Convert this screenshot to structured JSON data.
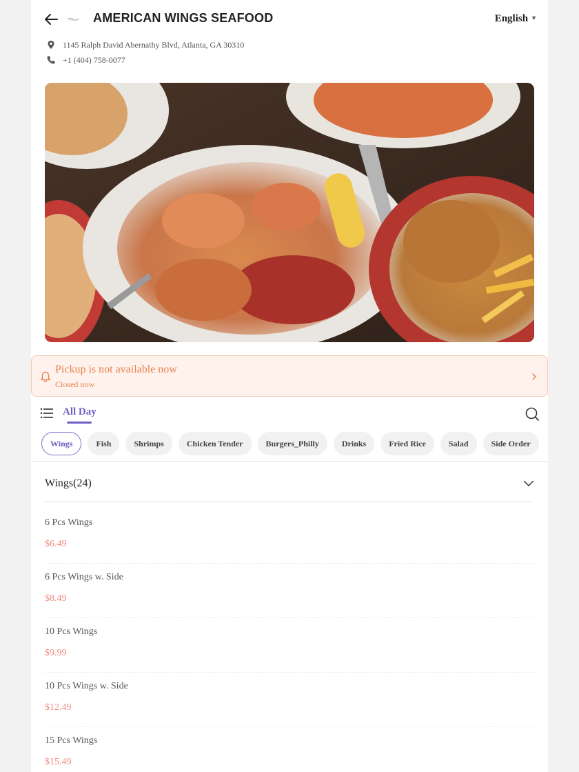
{
  "header": {
    "title": "AMERICAN WINGS SEAFOOD",
    "language": "English",
    "back_icon": "arrow-left-icon",
    "logo": "restaurant-logo"
  },
  "info": {
    "address": "1145 Ralph David Abernathy Blvd, Atlanta, GA 30310",
    "phone": "+1 (404) 758-0077"
  },
  "pickup": {
    "title": "Pickup is not available now",
    "subtitle": "Closed now"
  },
  "menu": {
    "active_menu": "All Day"
  },
  "categories": [
    "Wings",
    "Fish",
    "Shrimps",
    "Chicken Tender",
    "Burgers_Philly",
    "Drinks",
    "Fried Rice",
    "Salad",
    "Side Order"
  ],
  "section": {
    "title": "Wings(24)",
    "items": [
      {
        "name": "6 Pcs Wings",
        "price": "$6.49"
      },
      {
        "name": "6 Pcs Wings w. Side",
        "price": "$8.49"
      },
      {
        "name": "10 Pcs Wings",
        "price": "$9.99"
      },
      {
        "name": "10 Pcs Wings w. Side",
        "price": "$12.49"
      },
      {
        "name": "15 Pcs Wings",
        "price": "$15.49"
      }
    ]
  },
  "colors": {
    "accent": "#6a5fc1",
    "price": "#ef8a80",
    "notice_text": "#e8814f",
    "notice_bg": "#fff2ec"
  }
}
